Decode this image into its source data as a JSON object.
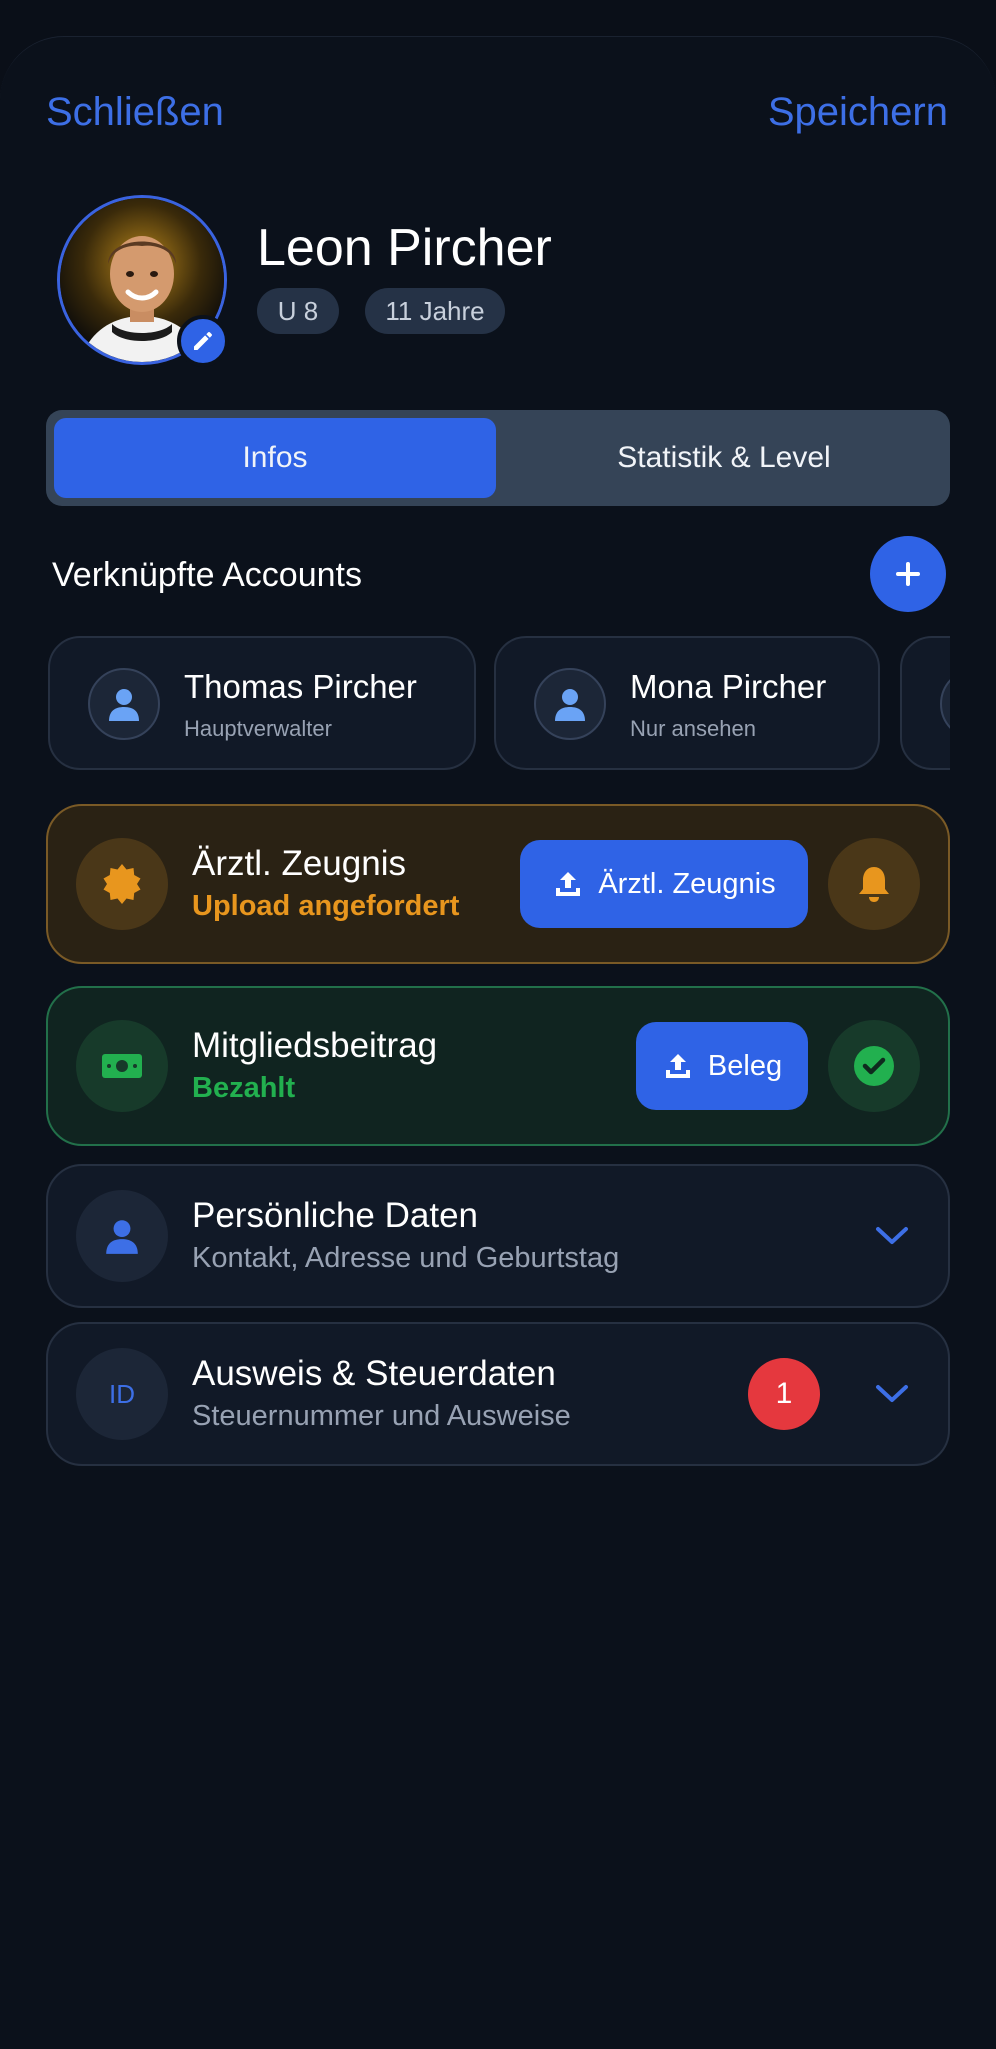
{
  "header": {
    "close_label": "Schließen",
    "save_label": "Speichern"
  },
  "profile": {
    "name": "Leon Pircher",
    "team_chip": "U 8",
    "age_chip": "11 Jahre"
  },
  "tabs": [
    {
      "label": "Infos",
      "active": true
    },
    {
      "label": "Statistik & Level",
      "active": false
    }
  ],
  "linked_accounts": {
    "title": "Verknüpfte Accounts",
    "items": [
      {
        "name": "Thomas Pircher",
        "role": "Hauptverwalter"
      },
      {
        "name": "Mona Pircher",
        "role": "Nur ansehen"
      }
    ]
  },
  "medical": {
    "title": "Ärztl. Zeugnis",
    "status": "Upload angefordert",
    "button_label": "Ärztl. Zeugnis"
  },
  "membership": {
    "title": "Mitgliedsbeitrag",
    "status": "Bezahlt",
    "button_label": "Beleg"
  },
  "personal": {
    "title": "Persönliche Daten",
    "subtitle": "Kontakt, Adresse und Geburtstag"
  },
  "id_tax": {
    "icon_text": "ID",
    "title": "Ausweis & Steuerdaten",
    "subtitle": "Steuernummer und Ausweise",
    "badge_count": "1"
  },
  "colors": {
    "accent": "#2f63e6",
    "warning": "#e8961e",
    "success": "#22b04f",
    "danger": "#e5383e",
    "background": "#0b111b"
  }
}
